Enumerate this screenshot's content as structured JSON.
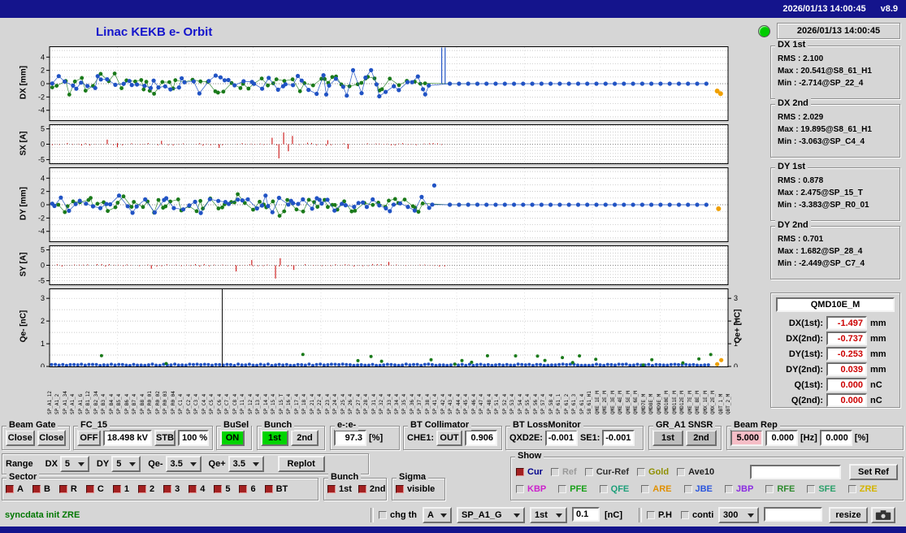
{
  "titlebar": {
    "datetime": "2026/01/13 14:00:45",
    "version": "v8.9"
  },
  "header": {
    "title": "Linac KEKB e- Orbit",
    "status_time": "2026/01/13 14:00:45"
  },
  "stats": [
    {
      "label": "DX 1st",
      "rms": "RMS : 2.100",
      "max": "Max : 20.541@S8_61_H1",
      "min": "Min : -2.714@SP_22_4"
    },
    {
      "label": "DX 2nd",
      "rms": "RMS : 2.029",
      "max": "Max : 19.895@S8_61_H1",
      "min": "Min : -3.063@SP_C4_4"
    },
    {
      "label": "DY 1st",
      "rms": "RMS : 0.878",
      "max": "Max : 2.475@SP_15_T",
      "min": "Min : -3.383@SP_R0_01"
    },
    {
      "label": "DY 2nd",
      "rms": "RMS : 0.701",
      "max": "Max : 1.682@SP_28_4",
      "min": "Min : -2.449@SP_C7_4"
    }
  ],
  "qmd": {
    "title": "QMD10E_M",
    "rows": [
      {
        "label": "DX(1st):",
        "value": "-1.497",
        "unit": "mm"
      },
      {
        "label": "DX(2nd):",
        "value": "-0.737",
        "unit": "mm"
      },
      {
        "label": "DY(1st):",
        "value": "-0.253",
        "unit": "mm"
      },
      {
        "label": "DY(2nd):",
        "value": "0.039",
        "unit": "mm"
      },
      {
        "label": "Q(1st):",
        "value": "0.000",
        "unit": "nC"
      },
      {
        "label": "Q(2nd):",
        "value": "0.000",
        "unit": "nC"
      }
    ]
  },
  "theme": {
    "blue": "#2153c4",
    "green": "#1a7a1a",
    "orange": "#f0a000",
    "red": "#cc1111",
    "navy": "#14148c",
    "green_btn": "#00d400",
    "pink": "#f6bdc6",
    "value_red": "#cc0000"
  },
  "plots": {
    "dx": {
      "ylabel": "DX [mm]",
      "yticks": [
        4,
        2,
        0,
        -2,
        -4
      ],
      "ymin": -5.5,
      "ymax": 5.5,
      "gridStep": 1,
      "type": "orbit",
      "blue": {
        "seed": 11,
        "n": 95,
        "xmax": 0.565,
        "amp": 2.4
      },
      "green": {
        "seed": 23,
        "n": 72,
        "xmax": 0.56,
        "amp": 2.0
      },
      "flat": {
        "start": 0.59,
        "end": 0.972,
        "step": 0.0135
      },
      "spikes": [
        0.578,
        0.583
      ],
      "extra": [],
      "orange": [
        [
          0.984,
          -1.1
        ],
        [
          0.989,
          -1.5
        ]
      ]
    },
    "sx": {
      "ylabel": "SX [A]",
      "yticks": [
        5,
        0,
        -5
      ],
      "ymin": -6.2,
      "ymax": 6.2,
      "gridStep": 1,
      "type": "stem",
      "seed": 51,
      "xmax": 0.59,
      "step": 0.005,
      "amp": 0.5,
      "spikes": [
        [
          0.085,
          1.5
        ],
        [
          0.1,
          -1.0
        ],
        [
          0.165,
          1.1
        ],
        [
          0.25,
          -1.2
        ],
        [
          0.328,
          2.1
        ],
        [
          0.338,
          -4.6
        ],
        [
          0.345,
          3.8
        ],
        [
          0.352,
          -2.3
        ],
        [
          0.358,
          2.7
        ],
        [
          0.41,
          1.3
        ],
        [
          0.44,
          -1.5
        ]
      ]
    },
    "dy": {
      "ylabel": "DY [mm]",
      "yticks": [
        4,
        2,
        0,
        -2,
        -4
      ],
      "ymin": -5.5,
      "ymax": 5.5,
      "gridStep": 1,
      "type": "orbit",
      "blue": {
        "seed": 33,
        "n": 95,
        "xmax": 0.565,
        "amp": 1.9
      },
      "green": {
        "seed": 47,
        "n": 72,
        "xmax": 0.56,
        "amp": 1.7
      },
      "flat": {
        "start": 0.59,
        "end": 0.972,
        "step": 0.0135
      },
      "spikes": [],
      "extra": [
        [
          0.567,
          2.9
        ]
      ],
      "orange": [
        [
          0.986,
          -0.6
        ]
      ]
    },
    "sy": {
      "ylabel": "SY [A]",
      "yticks": [
        5,
        0,
        -5
      ],
      "ymin": -6.2,
      "ymax": 6.2,
      "gridStep": 1,
      "type": "stem",
      "seed": 61,
      "xmax": 0.59,
      "step": 0.005,
      "amp": 0.45,
      "spikes": [
        [
          0.15,
          -1.1
        ],
        [
          0.275,
          -2.0
        ],
        [
          0.298,
          1.7
        ],
        [
          0.333,
          -4.3
        ],
        [
          0.34,
          2.3
        ],
        [
          0.36,
          -1.5
        ],
        [
          0.5,
          1.1
        ]
      ]
    },
    "q": {
      "ylabel": "Qe- [nC]",
      "ylabel_right": "Qe+ [nC]",
      "yticks": [
        3,
        2,
        1,
        0
      ],
      "ymin": 0,
      "ymax": 3.4,
      "gridStep": 0.5,
      "type": "charge",
      "blueStep": 0.0055,
      "blueBase": 0.07,
      "greenSeed": 77,
      "vline": 0.2545,
      "orange": [
        [
          0.984,
          0.1
        ],
        [
          0.99,
          0.28
        ]
      ]
    }
  },
  "xlabels": [
    "SP_A1_12",
    "SP_A1_2",
    "SP_A1_34",
    "SP_A1_4",
    "SP_A1_G",
    "SP_B1_12",
    "SP_B2_34",
    "SP_B3_4",
    "SP_B4_4",
    "SP_B5_4",
    "SP_B6_4",
    "SP_B7_4",
    "SP_B8_4",
    "SP_R0_01",
    "SP_R0_02",
    "SP_R0_03",
    "SP_R0_04",
    "SP_C1_4",
    "SP_C2_4",
    "SP_C3_4",
    "SP_C4_4",
    "SP_C5_4",
    "SP_C6_4",
    "SP_C7_4",
    "SP_C8_4",
    "SP_11_4",
    "SP_12_4",
    "SP_13_4",
    "SP_14_4",
    "SP_15_4",
    "SP_15_T",
    "SP_16_4",
    "SP_17_4",
    "SP_18_4",
    "SP_21_4",
    "SP_22_4",
    "SP_23_4",
    "SP_24_4",
    "SP_25_4",
    "SP_26_4",
    "SP_27_4",
    "SP_28_4",
    "SP_31_4",
    "SP_32_4",
    "SP_33_4",
    "SP_34_4",
    "SP_35_4",
    "SP_36_4",
    "SP_37_4",
    "SP_38_4",
    "SP_41_4",
    "SP_42_4",
    "SP_43_4",
    "SP_44_4",
    "SP_45_4",
    "SP_46_4",
    "SP_47_4",
    "SP_48_4",
    "SP_51_4",
    "SP_52_4",
    "SP_53_4",
    "SP_54_4",
    "SP_55_4",
    "SP_56_4",
    "SP_57_4",
    "SP_58_4",
    "SP_61_1",
    "SP_61_2",
    "SP_61_3",
    "SP_61_4",
    "S8_61_H1",
    "QME_1E_M",
    "QME_2E_M",
    "QME_3E_M",
    "QME_4E_M",
    "QME_5E_M",
    "QME_6E_M",
    "QMD7E_M",
    "QMD8E_M",
    "QMD9E_M",
    "QMD10E_M",
    "QMD11E_M",
    "QMD12E_M",
    "QME_7E_M",
    "QME_8E_M",
    "QMX_1E_M",
    "QMX_2E_M",
    "QBT_1_M",
    "QBT_2_M"
  ],
  "controls": {
    "beam_gate": {
      "label": "Beam Gate",
      "close1": "Close",
      "close2": "Close"
    },
    "fc15": {
      "label": "FC_15",
      "off": "OFF",
      "kv": "18.498 kV",
      "stb": "STB",
      "pct": "100 %"
    },
    "busel": {
      "label": "BuSel",
      "on": "ON"
    },
    "bunch": {
      "label": "Bunch",
      "first": "1st",
      "second": "2nd"
    },
    "ee": {
      "label": "e-:e-",
      "value": "97.3",
      "unit": "[%]"
    },
    "bt_collimator": {
      "label": "BT Collimator",
      "che1": "CHE1:",
      "out": "OUT",
      "value": "0.906"
    },
    "bt_lossmonitor": {
      "label": "BT LossMonitor",
      "qxd2e_label": "QXD2E:",
      "qxd2e_value": "-0.001",
      "se1_label": "SE1:",
      "se1_value": "-0.001"
    },
    "gr_a1": {
      "label": "GR_A1 SNSR",
      "first": "1st",
      "second": "2nd"
    },
    "beam_rep": {
      "label": "Beam Rep",
      "rate": "5.000",
      "v2": "0.000",
      "hz": "[Hz]",
      "v3": "0.000",
      "pct": "[%]"
    },
    "range": {
      "label": "Range",
      "dx_label": "DX",
      "dx": "5",
      "dy_label": "DY",
      "dy": "5",
      "qem_label": "Qe-",
      "qem": "3.5",
      "qep_label": "Qe+",
      "qep": "3.5",
      "replot": "Replot"
    },
    "sector": {
      "label": "Sector",
      "items": [
        "A",
        "B",
        "R",
        "C",
        "1",
        "2",
        "3",
        "4",
        "5",
        "6",
        "BT"
      ],
      "checked": true
    },
    "bunch2": {
      "label": "Bunch",
      "items": [
        "1st",
        "2nd"
      ],
      "checked": true
    },
    "sigma": {
      "label": "Sigma",
      "items": [
        "visible"
      ],
      "checked": true
    },
    "show": {
      "label": "Show",
      "row1": [
        {
          "text": "Cur",
          "color": "#00008b",
          "checked": true
        },
        {
          "text": "Ref",
          "color": "#9a9a9a",
          "checked": false
        },
        {
          "text": "Cur-Ref",
          "color": "#303030",
          "checked": false
        },
        {
          "text": "Gold",
          "color": "#8f8f00",
          "checked": false
        },
        {
          "text": "Ave10",
          "color": "#202020",
          "checked": false
        }
      ],
      "ref_input": "",
      "set_ref": "Set Ref",
      "row2": [
        {
          "text": "KBP",
          "color": "#cc22cc",
          "checked": false
        },
        {
          "text": "PFE",
          "color": "#17a017",
          "checked": false
        },
        {
          "text": "QFE",
          "color": "#1fa07a",
          "checked": false
        },
        {
          "text": "ARE",
          "color": "#e09000",
          "checked": false
        },
        {
          "text": "JBE",
          "color": "#2a55dd",
          "checked": false
        },
        {
          "text": "JBP",
          "color": "#8a2be2",
          "checked": false
        },
        {
          "text": "RFE",
          "color": "#2e8b2e",
          "checked": false
        },
        {
          "text": "SFE",
          "color": "#2aa06a",
          "checked": false
        },
        {
          "text": "ZRE",
          "color": "#d4b400",
          "checked": false
        }
      ]
    },
    "statusbar": {
      "message": "syncdata init ZRE",
      "chg_th": "chg th",
      "mode": "A",
      "device": "SP_A1_G",
      "bunch": "1st",
      "threshold": "0.1",
      "unit": "[nC]",
      "ph": "P.H",
      "conti": "conti",
      "interval": "300",
      "blank": "",
      "resize": "resize"
    }
  }
}
